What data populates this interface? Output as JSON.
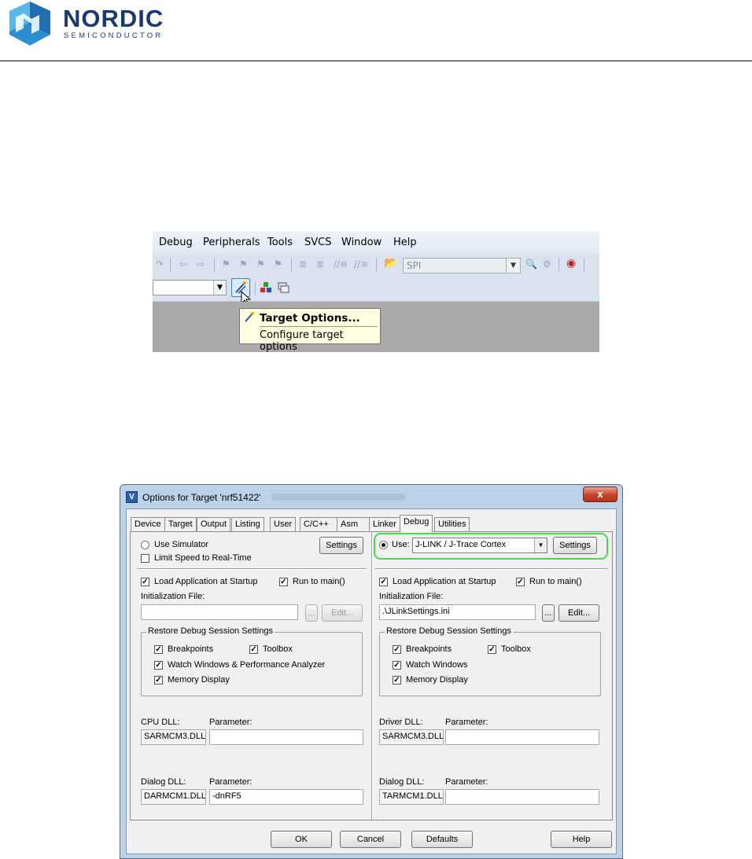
{
  "header": {
    "brand": "NORDIC",
    "brand_sub": "SEMICONDUCTOR"
  },
  "toolbar_screenshot": {
    "menu": [
      "Debug",
      "Peripherals",
      "Tools",
      "SVCS",
      "Window",
      "Help"
    ],
    "target_combo_value": "SPI",
    "tooltip_title": "Target Options...",
    "tooltip_desc": "Configure target options",
    "icons": [
      "wand-icon",
      "cursor-icon",
      "load-icon",
      "manage-icon"
    ]
  },
  "dialog": {
    "title": "Options for Target 'nrf51422'",
    "close": "x",
    "tabs": [
      "Device",
      "Target",
      "Output",
      "Listing",
      "User",
      "C/C++",
      "Asm",
      "Linker",
      "Debug",
      "Utilities"
    ],
    "active_tab": "Debug",
    "left": {
      "use_simulator": "Use Simulator",
      "settings": "Settings",
      "limit_speed": "Limit Speed to Real-Time",
      "load_app": "Load Application at Startup",
      "run_to_main": "Run to main()",
      "init_file_label": "Initialization File:",
      "init_file_value": "",
      "browse": "...",
      "edit": "Edit...",
      "restore_group": "Restore Debug Session Settings",
      "breakpoints": "Breakpoints",
      "toolbox": "Toolbox",
      "watch": "Watch Windows & Performance Analyzer",
      "memory": "Memory Display",
      "cpu_dll_label": "CPU DLL:",
      "cpu_param_label": "Parameter:",
      "cpu_dll": "SARMCM3.DLL",
      "cpu_param": "",
      "dialog_dll_label": "Dialog DLL:",
      "dialog_param_label": "Parameter:",
      "dialog_dll": "DARMCM1.DLL",
      "dialog_param": "-dnRF5"
    },
    "right": {
      "use": "Use:",
      "debugger": "J-LINK / J-Trace Cortex",
      "settings": "Settings",
      "load_app": "Load Application at Startup",
      "run_to_main": "Run to main()",
      "init_file_label": "Initialization File:",
      "init_file_value": ".\\JLinkSettings.ini",
      "browse": "...",
      "edit": "Edit...",
      "restore_group": "Restore Debug Session Settings",
      "breakpoints": "Breakpoints",
      "toolbox": "Toolbox",
      "watch": "Watch Windows",
      "memory": "Memory Display",
      "driver_dll_label": "Driver DLL:",
      "driver_param_label": "Parameter:",
      "driver_dll": "SARMCM3.DLL",
      "driver_param": "",
      "dialog_dll_label": "Dialog DLL:",
      "dialog_param_label": "Parameter:",
      "dialog_dll": "TARMCM1.DLL",
      "dialog_param": ""
    },
    "buttons": {
      "ok": "OK",
      "cancel": "Cancel",
      "defaults": "Defaults",
      "help": "Help"
    },
    "colors": {
      "highlight": "#4bd64b",
      "title_frame": "#bcd2ea",
      "close_button": "#c7442a"
    }
  }
}
